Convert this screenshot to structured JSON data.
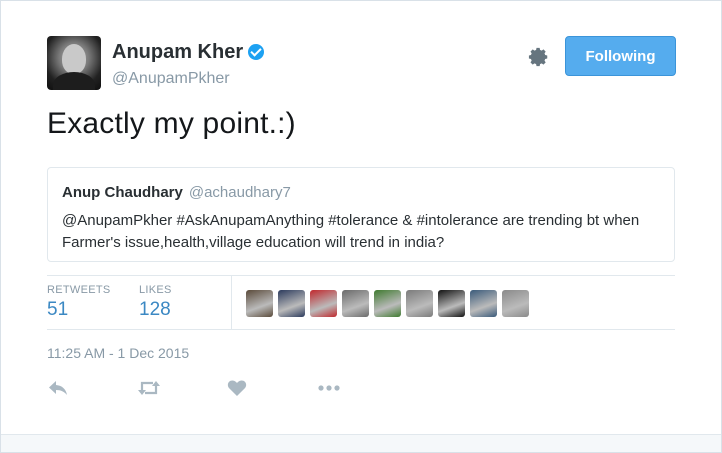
{
  "author": {
    "display_name": "Anupam Kher",
    "handle": "@AnupamPkher",
    "verified": true
  },
  "follow_button_label": "Following",
  "tweet_text": "Exactly my point.:)",
  "quoted_tweet": {
    "name": "Anup Chaudhary",
    "handle": "@achaudhary7",
    "text": "@AnupamPkher #AskAnupamAnything  #tolerance & #intolerance are trending bt when Farmer's issue,health,village education will trend in india?"
  },
  "stats": {
    "retweets_label": "RETWEETS",
    "retweets_count": "51",
    "likes_label": "LIKES",
    "likes_count": "128"
  },
  "likers": [
    {
      "color": "#5a4a3a"
    },
    {
      "color": "#2b3a5c"
    },
    {
      "color": "#c0282d"
    },
    {
      "color": "#6a6a6a"
    },
    {
      "color": "#3f7a2f"
    },
    {
      "color": "#7b7b7b"
    },
    {
      "color": "#111111"
    },
    {
      "color": "#3a5a7a"
    },
    {
      "color": "#8a8a8a"
    }
  ],
  "timestamp": "11:25 AM - 1 Dec 2015",
  "actions": [
    "reply-icon",
    "retweet-icon",
    "like-icon",
    "more-icon"
  ],
  "colors": {
    "accent": "#55acee",
    "link_blue": "#3b88c3",
    "muted": "#8899a6",
    "verified": "#1da1f2"
  }
}
